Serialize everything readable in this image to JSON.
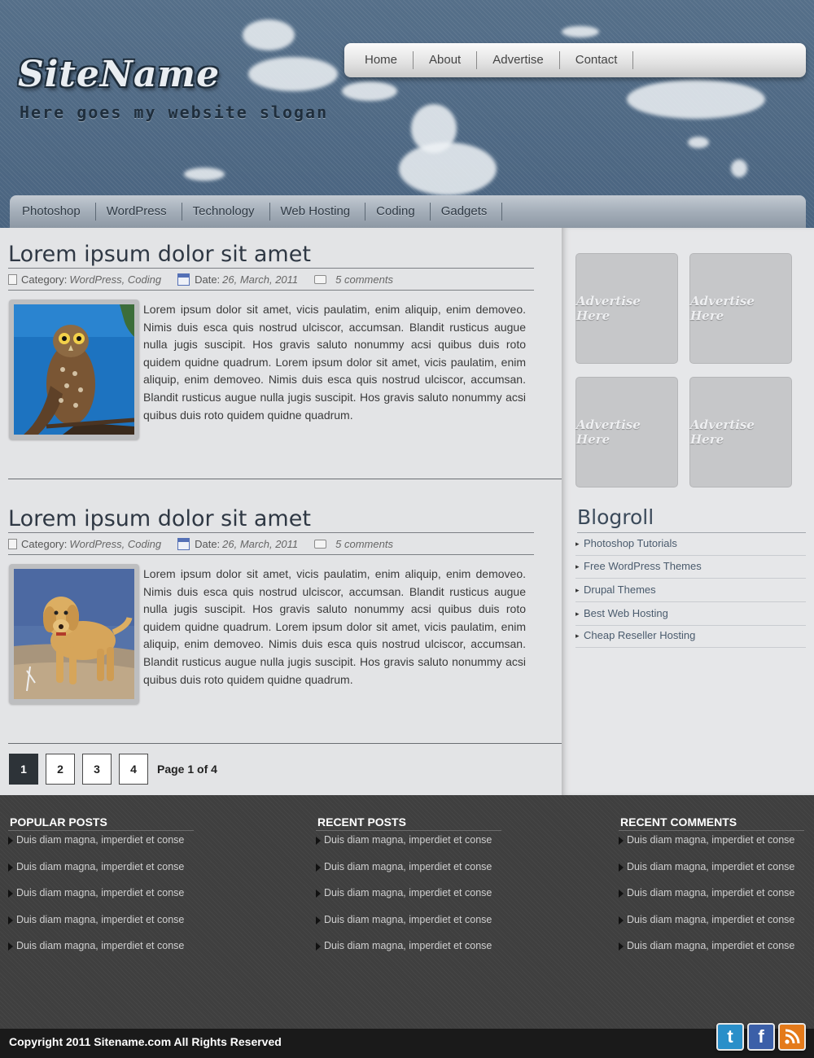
{
  "header": {
    "site_name": "SiteName",
    "slogan": "Here goes my website slogan"
  },
  "top_nav": [
    "Home",
    "About",
    "Advertise",
    "Contact"
  ],
  "category_nav": [
    "Photoshop",
    "WordPress",
    "Technology",
    "Web Hosting",
    "Coding",
    "Gadgets"
  ],
  "posts": [
    {
      "title": "Lorem ipsum dolor sit amet",
      "category_label": "Category:",
      "categories": "WordPress, Coding",
      "date_label": "Date:",
      "date": "26, March, 2011",
      "comments": "5 comments",
      "image": "owl-photo",
      "body": "Lorem ipsum dolor sit amet, vicis paulatim, enim aliquip, enim demoveo. Nimis duis esca quis nostrud ulciscor, accumsan. Blandit rusticus augue nulla jugis suscipit. Hos gravis saluto nonummy acsi quibus duis roto quidem quidne quadrum. Lorem ipsum dolor sit amet, vicis paulatim, enim aliquip, enim demoveo. Nimis duis esca quis nostrud ulciscor, accumsan. Blandit rusticus augue nulla jugis suscipit. Hos gravis saluto nonummy acsi quibus duis roto quidem quidne quadrum."
    },
    {
      "title": "Lorem ipsum dolor sit amet",
      "category_label": "Category:",
      "categories": "WordPress, Coding",
      "date_label": "Date:",
      "date": "26, March, 2011",
      "comments": "5 comments",
      "image": "dog-photo",
      "body": "Lorem ipsum dolor sit amet, vicis paulatim, enim aliquip, enim demoveo. Nimis duis esca quis nostrud ulciscor, accumsan. Blandit rusticus augue nulla jugis suscipit. Hos gravis saluto nonummy acsi quibus duis roto quidem quidne quadrum. Lorem ipsum dolor sit amet, vicis paulatim, enim aliquip, enim demoveo. Nimis duis esca quis nostrud ulciscor, accumsan. Blandit rusticus augue nulla jugis suscipit. Hos gravis saluto nonummy acsi quibus duis roto quidem quidne quadrum."
    }
  ],
  "pagination": {
    "pages": [
      "1",
      "2",
      "3",
      "4"
    ],
    "current": "1",
    "info": "Page 1 of 4"
  },
  "sidebar": {
    "ads": [
      "Advertise Here",
      "Advertise Here",
      "Advertise Here",
      "Advertise Here"
    ],
    "blogroll_title": "Blogroll",
    "blogroll": [
      "Photoshop Tutorials",
      "Free WordPress Themes",
      "Drupal Themes",
      "Best Web Hosting",
      "Cheap Reseller Hosting"
    ]
  },
  "footer": {
    "popular_title": "POPULAR POSTS",
    "recent_title": "RECENT POSTS",
    "comments_title": "RECENT COMMENTS",
    "popular": [
      "Duis diam magna, imperdiet et conse",
      "Duis diam magna, imperdiet et conse",
      "Duis diam magna, imperdiet et conse",
      "Duis diam magna, imperdiet et conse",
      "Duis diam magna, imperdiet et conse"
    ],
    "recent": [
      "Duis diam magna, imperdiet et conse",
      "Duis diam magna, imperdiet et conse",
      "Duis diam magna, imperdiet et conse",
      "Duis diam magna, imperdiet et conse",
      "Duis diam magna, imperdiet et conse"
    ],
    "comments": [
      "Duis diam magna, imperdiet et conse",
      "Duis diam magna, imperdiet et conse",
      "Duis diam magna, imperdiet et conse",
      "Duis diam magna, imperdiet et conse",
      "Duis diam magna, imperdiet et conse"
    ],
    "copyright": "Copyright  2011 Sitename.com All Rights Reserved"
  },
  "social": [
    {
      "name": "twitter-icon",
      "color": "#2a8fc9"
    },
    {
      "name": "facebook-icon",
      "color": "#3b5fa8"
    },
    {
      "name": "rss-icon",
      "color": "#e47a1a"
    }
  ],
  "colors": {
    "header_bg": "#4d6a85",
    "footer_bg": "#3f3f3f",
    "title_text": "#2f3844"
  }
}
